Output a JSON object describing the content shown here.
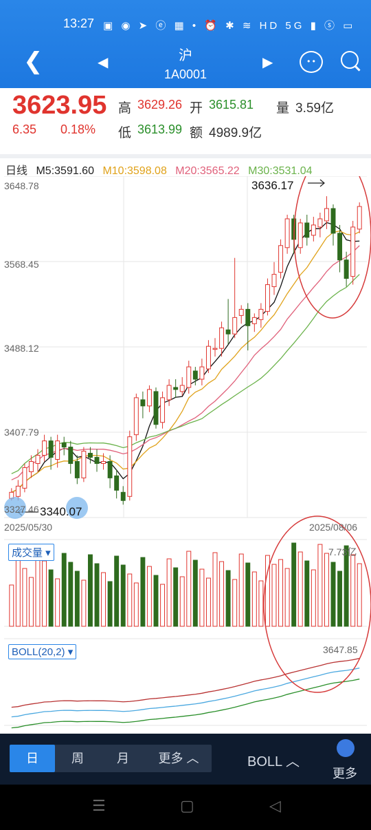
{
  "status_bar": {
    "time": "13:27",
    "icons_text": "▣ ◉ ➤ ⓔ ▦ • ⏰ ✱ ≋ HD 5G ▮ ⓢ ▭"
  },
  "nav": {
    "back_icon": "chevron-left-icon",
    "market": "沪",
    "code": "1A0001",
    "prev_icon": "triangle-left-icon",
    "next_icon": "triangle-right-icon",
    "msg_text": "• •"
  },
  "quote": {
    "price": "3623.95",
    "change": "6.35",
    "change_pct": "0.18%",
    "high_label": "高",
    "high": "3629.26",
    "open_label": "开",
    "open": "3615.81",
    "vol_label": "量",
    "vol": "3.59亿",
    "low_label": "低",
    "low": "3613.99",
    "amt_label": "额",
    "amt": "4989.9亿"
  },
  "ma_row": {
    "period": "日线",
    "m5": "M5:3591.60",
    "m10": "M10:3598.08",
    "m20": "M20:3565.22",
    "m30": "M30:3531.04"
  },
  "price_axis": {
    "p1": "3648.78",
    "p2": "3568.45",
    "p3": "3488.12",
    "p4": "3407.79",
    "p5": "3327.46"
  },
  "annotations": {
    "high_label": "3636.17",
    "low_label": "3340.07"
  },
  "dates": {
    "start": "2025/05/30",
    "end": "2025/08/06"
  },
  "volume_panel": {
    "label": "成交量 ▾",
    "value": "7.73亿"
  },
  "boll_panel": {
    "label": "BOLL(20,2) ▾",
    "value": "3647.85"
  },
  "bottom_tabs": {
    "day": "日",
    "week": "周",
    "month": "月",
    "more": "更多 ︿",
    "boll": "BOLL ︿",
    "more_right": "更多"
  },
  "colors": {
    "up": "#e0342e",
    "down": "#2e6b1e",
    "brand": "#2a86e8"
  },
  "chart_data": {
    "type": "candlestick",
    "ylim": [
      3327.46,
      3648.78
    ],
    "candles": [
      [
        3342,
        3348,
        3340,
        3352
      ],
      [
        3344,
        3354,
        3340,
        3360
      ],
      [
        3352,
        3372,
        3348,
        3376
      ],
      [
        3368,
        3378,
        3362,
        3384
      ],
      [
        3376,
        3384,
        3368,
        3390
      ],
      [
        3384,
        3398,
        3378,
        3404
      ],
      [
        3398,
        3382,
        3370,
        3402
      ],
      [
        3380,
        3398,
        3372,
        3404
      ],
      [
        3396,
        3392,
        3384,
        3402
      ],
      [
        3392,
        3376,
        3366,
        3398
      ],
      [
        3378,
        3362,
        3356,
        3384
      ],
      [
        3362,
        3388,
        3358,
        3392
      ],
      [
        3386,
        3382,
        3376,
        3392
      ],
      [
        3382,
        3376,
        3368,
        3390
      ],
      [
        3376,
        3378,
        3370,
        3386
      ],
      [
        3378,
        3362,
        3352,
        3384
      ],
      [
        3364,
        3350,
        3342,
        3370
      ],
      [
        3348,
        3340,
        3336,
        3354
      ],
      [
        3344,
        3402,
        3340,
        3408
      ],
      [
        3404,
        3440,
        3398,
        3444
      ],
      [
        3438,
        3432,
        3420,
        3446
      ],
      [
        3432,
        3448,
        3426,
        3452
      ],
      [
        3446,
        3414,
        3410,
        3450
      ],
      [
        3416,
        3440,
        3410,
        3446
      ],
      [
        3438,
        3452,
        3432,
        3458
      ],
      [
        3450,
        3448,
        3440,
        3458
      ],
      [
        3446,
        3452,
        3442,
        3460
      ],
      [
        3450,
        3470,
        3444,
        3476
      ],
      [
        3466,
        3458,
        3452,
        3470
      ],
      [
        3458,
        3470,
        3452,
        3478
      ],
      [
        3468,
        3490,
        3464,
        3496
      ],
      [
        3488,
        3488,
        3480,
        3498
      ],
      [
        3488,
        3508,
        3480,
        3514
      ],
      [
        3506,
        3502,
        3492,
        3536
      ],
      [
        3502,
        3518,
        3498,
        3576
      ],
      [
        3520,
        3526,
        3512,
        3530
      ],
      [
        3526,
        3510,
        3486,
        3532
      ],
      [
        3512,
        3518,
        3504,
        3522
      ],
      [
        3516,
        3526,
        3508,
        3532
      ],
      [
        3524,
        3550,
        3520,
        3556
      ],
      [
        3548,
        3560,
        3540,
        3572
      ],
      [
        3562,
        3588,
        3556,
        3594
      ],
      [
        3586,
        3614,
        3580,
        3618
      ],
      [
        3614,
        3594,
        3580,
        3618
      ],
      [
        3586,
        3610,
        3580,
        3614
      ],
      [
        3610,
        3596,
        3588,
        3618
      ],
      [
        3598,
        3608,
        3592,
        3616
      ],
      [
        3606,
        3614,
        3596,
        3620
      ],
      [
        3612,
        3624,
        3604,
        3636
      ],
      [
        3624,
        3600,
        3588,
        3628
      ],
      [
        3600,
        3574,
        3562,
        3608
      ],
      [
        3574,
        3556,
        3548,
        3582
      ],
      [
        3558,
        3606,
        3550,
        3612
      ],
      [
        3604,
        3626,
        3600,
        3630
      ]
    ]
  }
}
